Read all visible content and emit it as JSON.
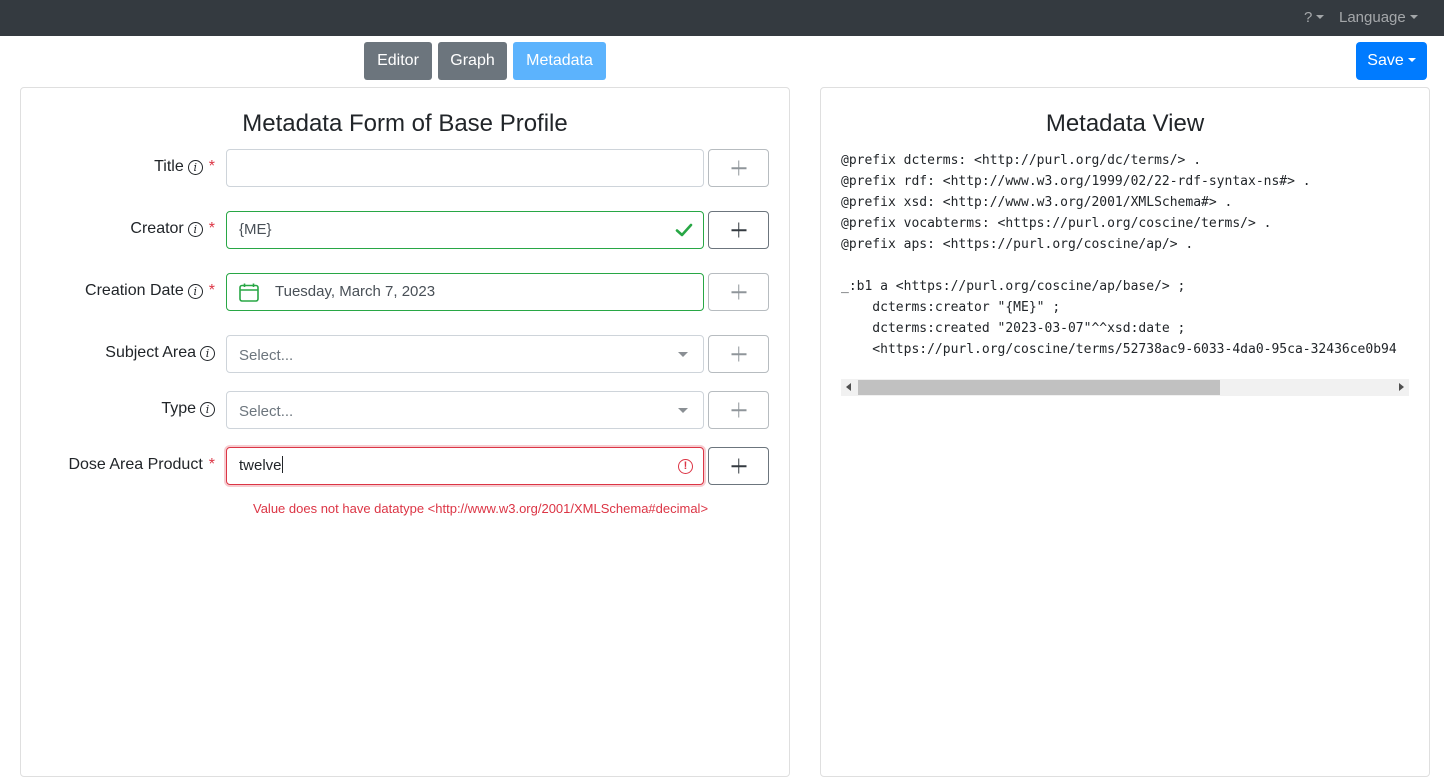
{
  "navbar": {
    "help_label": "?",
    "language_label": "Language"
  },
  "tabs": [
    {
      "label": "Editor"
    },
    {
      "label": "Graph"
    },
    {
      "label": "Metadata",
      "active": true
    }
  ],
  "save_label": "Save",
  "form": {
    "title": "Metadata Form of Base Profile",
    "required_mark": "*",
    "info_glyph": "i",
    "fields": {
      "title": {
        "label": "Title",
        "value": ""
      },
      "creator": {
        "label": "Creator",
        "value": "{ME}"
      },
      "creation_date": {
        "label": "Creation Date",
        "value": "Tuesday, March 7, 2023"
      },
      "subject_area": {
        "label": "Subject Area",
        "placeholder": "Select..."
      },
      "type": {
        "label": "Type",
        "placeholder": "Select..."
      },
      "dose_area_product": {
        "label": "Dose Area Product",
        "value": "twelve"
      }
    },
    "error_message": "Value does not have datatype <http://www.w3.org/2001/XMLSchema#decimal>",
    "error_glyph": "!"
  },
  "metadata_view": {
    "title": "Metadata View",
    "code": "@prefix dcterms: <http://purl.org/dc/terms/> .\n@prefix rdf: <http://www.w3.org/1999/02/22-rdf-syntax-ns#> .\n@prefix xsd: <http://www.w3.org/2001/XMLSchema#> .\n@prefix vocabterms: <https://purl.org/coscine/terms/> .\n@prefix aps: <https://purl.org/coscine/ap/> .\n\n_:b1 a <https://purl.org/coscine/ap/base/> ;\n    dcterms:creator \"{ME}\" ;\n    dcterms:created \"2023-03-07\"^^xsd:date ;\n    <https://purl.org/coscine/terms/52738ac9-6033-4da0-95ca-32436ce0b94"
  },
  "colors": {
    "navbar": "#343a40",
    "primary": "#007bff",
    "secondary": "#6c757d",
    "active_tab": "#5cb3fd",
    "valid": "#28a745",
    "invalid": "#dc3545"
  }
}
